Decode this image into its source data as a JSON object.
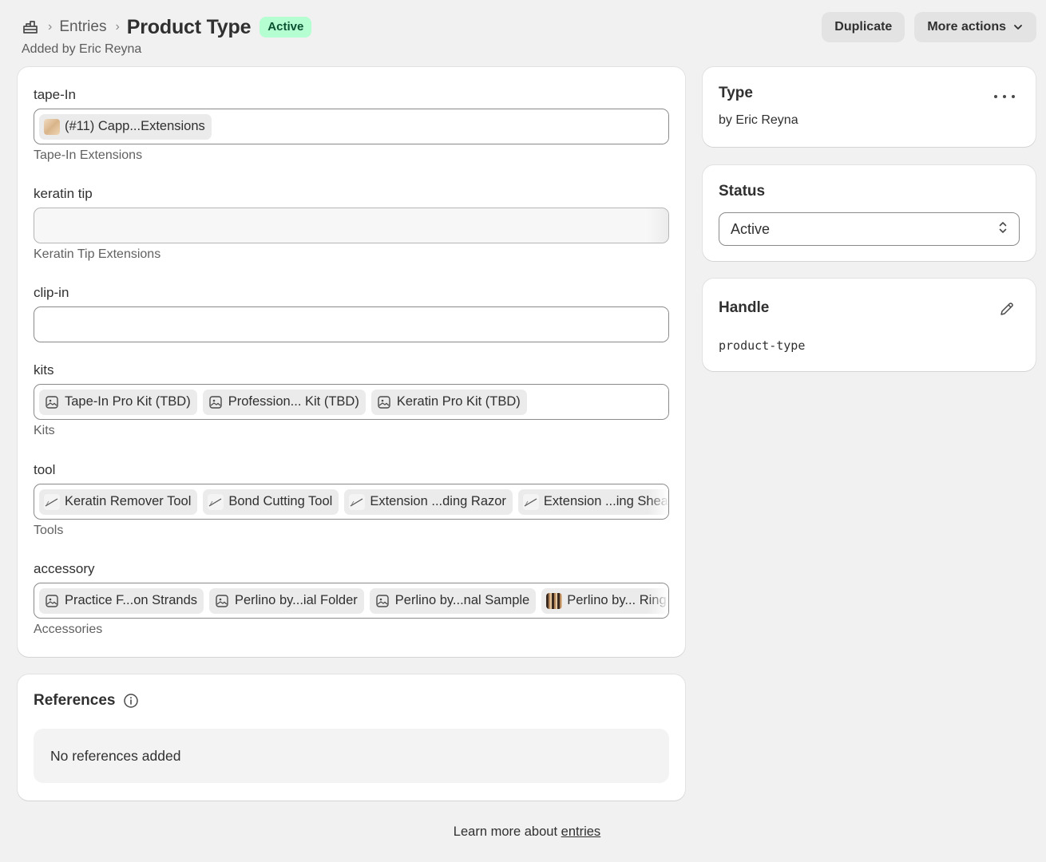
{
  "breadcrumb": {
    "home_icon": "metaobjects-icon",
    "parent": "Entries",
    "title": "Product Type",
    "status_badge": "Active",
    "subtitle": "Added by Eric Reyna"
  },
  "actions": {
    "duplicate": "Duplicate",
    "more": "More actions"
  },
  "fields": [
    {
      "label": "tape-In",
      "help": "Tape-In Extensions",
      "chips": [
        {
          "text": "(#11) Capp...Extensions",
          "thumb": "hair-image"
        }
      ]
    },
    {
      "label": "keratin tip",
      "help": "Keratin Tip Extensions",
      "chips": []
    },
    {
      "label": "clip-in",
      "help": "",
      "chips": []
    },
    {
      "label": "kits",
      "help": "Kits",
      "chips": [
        {
          "text": "Tape-In Pro Kit (TBD)",
          "thumb": "image-placeholder-icon"
        },
        {
          "text": "Profession... Kit (TBD)",
          "thumb": "image-placeholder-icon"
        },
        {
          "text": "Keratin Pro Kit (TBD)",
          "thumb": "image-placeholder-icon"
        }
      ]
    },
    {
      "label": "tool",
      "help": "Tools",
      "chips": [
        {
          "text": "Keratin Remover Tool",
          "thumb": "tool-image"
        },
        {
          "text": "Bond Cutting Tool",
          "thumb": "tool-image"
        },
        {
          "text": "Extension ...ding Razor",
          "thumb": "tool-image"
        },
        {
          "text": "Extension ...ing Shears",
          "thumb": "tool-image"
        }
      ]
    },
    {
      "label": "accessory",
      "help": "Accessories",
      "chips": [
        {
          "text": "Practice F...on Strands",
          "thumb": "image-placeholder-icon"
        },
        {
          "text": "Perlino by...ial Folder",
          "thumb": "image-placeholder-icon"
        },
        {
          "text": "Perlino by...nal Sample",
          "thumb": "image-placeholder-icon"
        },
        {
          "text": "Perlino by... Ring",
          "thumb": "hair-image"
        }
      ]
    }
  ],
  "type_card": {
    "title": "Type",
    "by": "by Eric Reyna"
  },
  "status_card": {
    "title": "Status",
    "value": "Active"
  },
  "handle_card": {
    "title": "Handle",
    "value": "product-type"
  },
  "references": {
    "title": "References",
    "empty": "No references added"
  },
  "footer": {
    "text": "Learn more about",
    "link": "entries"
  },
  "colors": {
    "badge_bg": "#b4fed2",
    "badge_text": "#0c5132",
    "page_bg": "#f1f1f1"
  }
}
